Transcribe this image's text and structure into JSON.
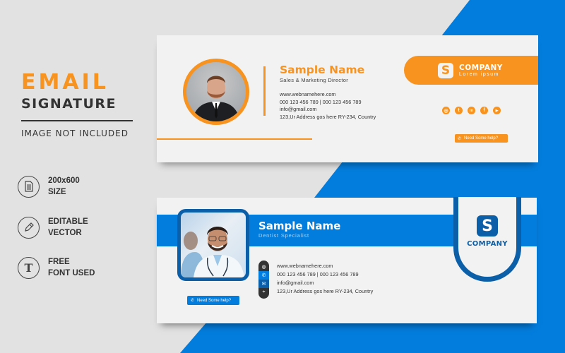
{
  "promo": {
    "title_line1": "EMAIL",
    "title_line2": "SIGNATURE",
    "note": "IMAGE NOT INCLUDED",
    "features": [
      {
        "icon": "document-icon",
        "line1": "200x600",
        "line2": "SIZE"
      },
      {
        "icon": "pencil-icon",
        "line1": "EDITABLE",
        "line2": "VECTOR"
      },
      {
        "icon": "text-font-icon",
        "line1": "FREE",
        "line2": "FONT USED"
      }
    ]
  },
  "card_orange": {
    "accent": "#f7931e",
    "name": "Sample Name",
    "role": "Sales & Marketing Director",
    "website": "www.webnamehere.com",
    "phones": "000 123 456 789 | 000 123 456 789",
    "email": "info@gmail.com",
    "address": "123,Ur Address gos here RY-234, Country",
    "company_letter": "S",
    "company_name": "COMPANY",
    "company_tagline": "Lorem ipsum",
    "socials": [
      {
        "name": "instagram",
        "glyph": "◎"
      },
      {
        "name": "tumblr",
        "glyph": "t"
      },
      {
        "name": "linkedin",
        "glyph": "in"
      },
      {
        "name": "facebook",
        "glyph": "f"
      },
      {
        "name": "youtube",
        "glyph": "▶"
      }
    ],
    "help_label": "Need Some help?"
  },
  "card_blue": {
    "accent": "#037ddd",
    "dark_accent": "#0b5fa8",
    "name": "Sample Name",
    "role": "Dentist Specialist",
    "website": "www.webnamehere.com",
    "phones": "000 123 456 789 | 000 123 456 789",
    "email": "info@gmail.com",
    "address": "123,Ur Address gos here RY-234, Country",
    "company_letter": "S",
    "company_name": "COMPANY",
    "help_label": "Need Some help?"
  }
}
